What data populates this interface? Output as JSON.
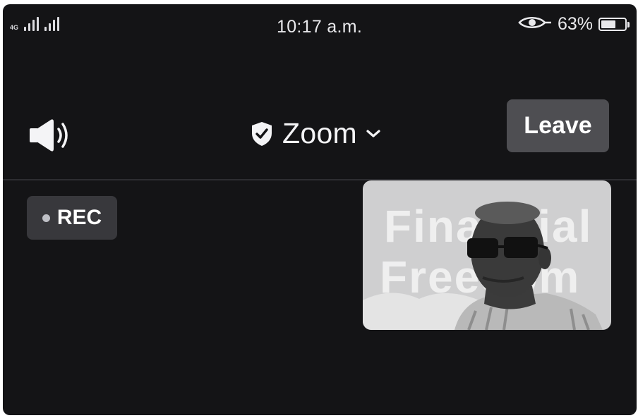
{
  "status_bar": {
    "network_type": "4G",
    "time": "10:17 a.m.",
    "battery_percent": "63%",
    "battery_level": 0.63,
    "icons": [
      "signal-bars-icon",
      "eye-icon",
      "battery-icon"
    ]
  },
  "meeting": {
    "title": "Zoom",
    "leave_label": "Leave",
    "speaker_icon": "speaker-icon",
    "security_icon": "shield-check-icon",
    "dropdown_icon": "chevron-down-icon"
  },
  "recording": {
    "label": "REC"
  },
  "video": {
    "background_text_line1": "Financial",
    "background_text_line2": "Freedom"
  },
  "colors": {
    "background": "#141416",
    "leave_button": "#4e4e52",
    "rec_badge": "#38383c",
    "text": "#f4f4f6"
  }
}
